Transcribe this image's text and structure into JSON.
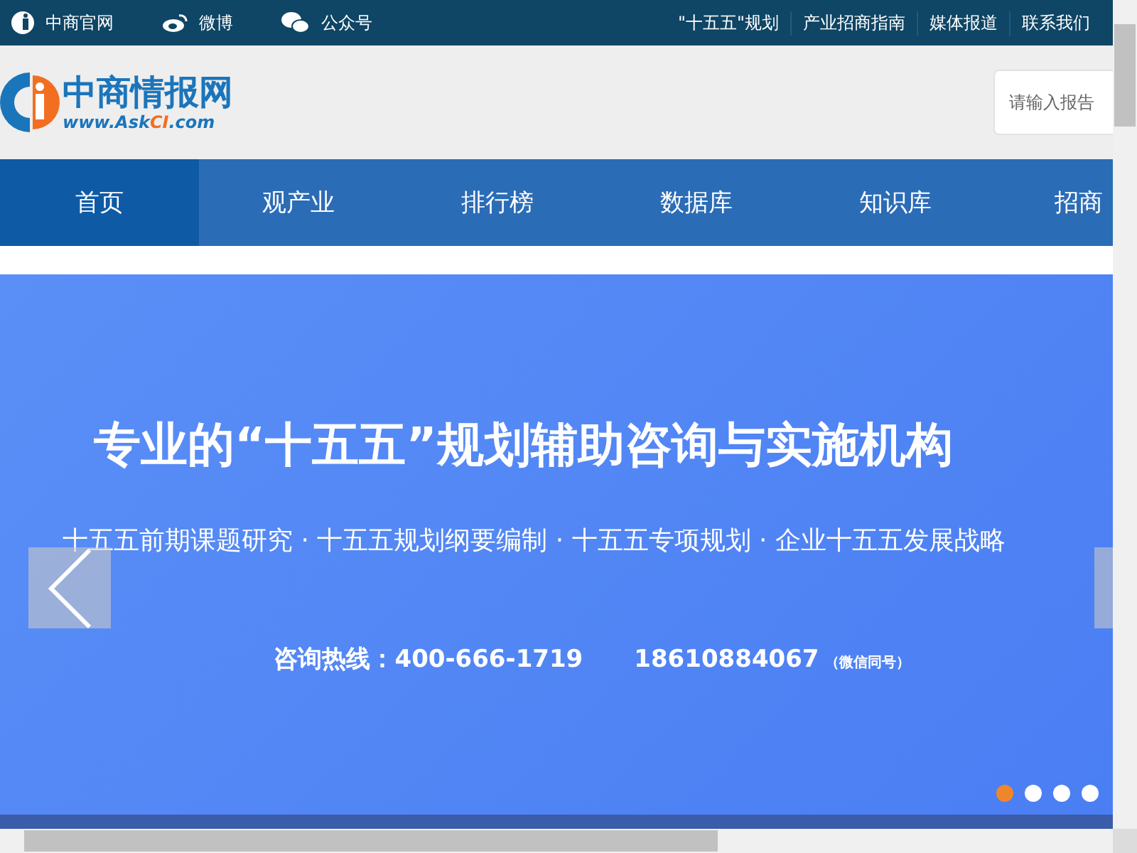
{
  "top_bar": {
    "links": [
      {
        "kind": "logo",
        "label": "中商官网"
      },
      {
        "kind": "weibo",
        "label": "微博"
      },
      {
        "kind": "wechat",
        "label": "公众号"
      }
    ],
    "right_links": [
      "\"十五五\"规划",
      "产业招商指南",
      "媒体报道",
      "联系我们"
    ]
  },
  "header": {
    "logo_name": "中商情报网",
    "logo_url": "www.Ask**CI**.com",
    "search": {
      "placeholder": "请输入报告"
    }
  },
  "nav": [
    {
      "label": "首页",
      "selected": true
    },
    {
      "label": "观产业",
      "selected": false
    },
    {
      "label": "排行榜",
      "selected": false
    },
    {
      "label": "数据库",
      "selected": false
    },
    {
      "label": "知识库",
      "selected": false
    },
    {
      "label": "招商",
      "selected": false
    }
  ],
  "banner": {
    "title": "专业的“十五五”规划辅助咨询与实施机构",
    "subtitle": "十五五前期课题研究 · 十五五规划纲要编制 · 十五五专项规划 · 企业十五五发展战略",
    "hotline": "咨询热线：400-666-1719",
    "mobile": "18610884067",
    "note": "（微信同号）",
    "dots": [
      {
        "selected": true
      },
      {
        "selected": false
      },
      {
        "selected": false
      },
      {
        "selected": false
      }
    ]
  }
}
